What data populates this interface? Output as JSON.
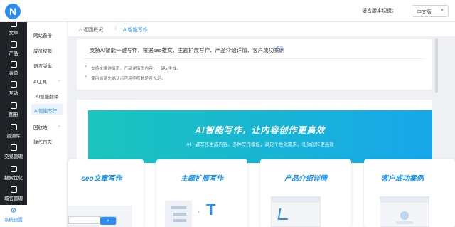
{
  "app": {
    "logo_letter": "N"
  },
  "header": {
    "lang_label": "语言版本切换：",
    "lang_selected": "中文版"
  },
  "sidenav": {
    "items": [
      {
        "label": "文章",
        "icon": "article-icon"
      },
      {
        "label": "产品",
        "icon": "product-icon"
      },
      {
        "label": "表单",
        "icon": "form-icon"
      },
      {
        "label": "互动",
        "icon": "interaction-icon"
      },
      {
        "label": "图册",
        "icon": "album-icon"
      },
      {
        "label": "资源库",
        "icon": "resource-icon"
      },
      {
        "label": "交易管理",
        "icon": "trade-icon"
      },
      {
        "label": "搜索优化",
        "icon": "seo-icon"
      },
      {
        "label": "域名管理",
        "icon": "domain-icon"
      }
    ],
    "bottom": {
      "label": "系统设置",
      "icon": "gear-icon"
    }
  },
  "submenu": {
    "items": [
      {
        "label": "网站备份"
      },
      {
        "label": "成员权限"
      },
      {
        "label": "语言版本"
      },
      {
        "label": "AI工具",
        "has_arrow": true
      },
      {
        "label": "AI智能翻译"
      },
      {
        "label": "AI智能写作",
        "active": true
      },
      {
        "label": "回收站",
        "has_arrow": true
      },
      {
        "label": "操作日志"
      }
    ]
  },
  "breadcrumb": {
    "home": "返回概况",
    "separator": "/",
    "current": "AI智能写作"
  },
  "info": {
    "title": "支持AI智能一键写作，根据seo推文、主题扩展写作、产品介绍详情、客户成功案例",
    "bullets": [
      "支持文章详情页、产品详情页内容，一键ai生成。",
      "使用前请先确认点可用字符数是否充足。"
    ]
  },
  "banner": {
    "title": "AI智能写作，让内容创作更高效",
    "subtitle": "AI一键写作生成内容。多种写作模板，满足个性化需求，让你创作更高效"
  },
  "features": [
    {
      "title": "seo文章写作"
    },
    {
      "title": "主题扩展写作"
    },
    {
      "title": "产品介绍详情"
    },
    {
      "title": "客户成功案例"
    }
  ],
  "colors": {
    "accent": "#2d8cf0",
    "nav_bg": "#1f2226",
    "banner_from": "#1bc5bd",
    "banner_to": "#17a6ea"
  }
}
